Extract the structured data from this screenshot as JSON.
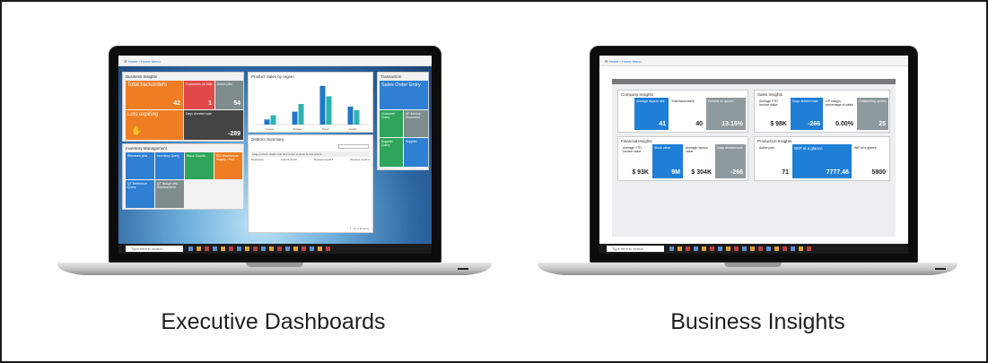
{
  "captions": {
    "left": "Executive Dashboards",
    "right": "Business Insights"
  },
  "left_screen": {
    "breadcrumb": "Home  ›  Home Menu",
    "business_insights": {
      "title": "Business Insights",
      "tiles": [
        {
          "label": "Total backorders",
          "value": "42"
        },
        {
          "label": "Customers on hold",
          "value": "1"
        },
        {
          "label": "Active jobs",
          "value": "54"
        },
        {
          "label": "Lots expiring",
          "value": ""
        },
        {
          "label": "Days directed sale",
          "value": "-289"
        }
      ]
    },
    "inventory_management": {
      "title": "Inventory Management",
      "tiles": [
        "Released jobs",
        "Inventory Query",
        "Stock Counts",
        "EDI Warehouse Supply / Fwd",
        "QT Reference Query",
        "QT Assign with Replacement"
      ]
    },
    "product_sales": {
      "title": "Product Sales by region",
      "categories": [
        "Leisure",
        "Outdoor",
        "Travel",
        "Hobby"
      ],
      "series": [
        {
          "color": "#1f77c9",
          "values": [
            10,
            25,
            75,
            35
          ]
        },
        {
          "color": "#2bb3b0",
          "values": [
            18,
            40,
            55,
            28
          ]
        }
      ]
    },
    "debtors_summary": {
      "title": "Debtors Summary",
      "hint": "Drag a column header and drop it here to group by that column",
      "columns": [
        "Description",
        "Current month",
        "Previous month 1",
        "Previous month 2"
      ],
      "footer": "1 - 11 of 11 items"
    },
    "transaction": {
      "title": "Transaction",
      "tiles": [
        "Sales Order Entry",
        "Customer Query",
        "AP Invoice Document",
        "Supplier Query",
        "Supplier"
      ]
    },
    "taskbar_search": "Type here to search"
  },
  "right_screen": {
    "breadcrumb": "Home  ›  Home Menu",
    "company_insights": {
      "title": "Company Insights",
      "tiles": [
        {
          "label": "Average days to sell",
          "value": "41"
        },
        {
          "label": "Total backorders",
          "value": "40"
        },
        {
          "label": "Returns on quotes",
          "value": "13.16%"
        }
      ]
    },
    "sales_insights": {
      "title": "Sales Insights",
      "tiles": [
        {
          "label": "Average YTD Invoice value",
          "value": "$ 98K"
        },
        {
          "label": "Days directed sale",
          "value": "-266"
        },
        {
          "label": "GP margin percentage of sales",
          "value": "0.00%"
        },
        {
          "label": "Outstanding quotes",
          "value": "25"
        }
      ]
    },
    "financial_insights": {
      "title": "Financial Insights",
      "tiles": [
        {
          "label": "Average YTD Invoice value",
          "value": "$ 93K"
        },
        {
          "label": "Stock value",
          "value": "9M"
        },
        {
          "label": "Average invoice value",
          "value": "$ 304K"
        },
        {
          "label": "Days directed sale",
          "value": "-266"
        }
      ]
    },
    "production_insights": {
      "title": "Production Insights",
      "tiles": [
        {
          "label": "Active jobs",
          "value": "71"
        },
        {
          "label": "WIP at a glance",
          "value": "7777.46"
        },
        {
          "label": "WIP at a glance",
          "value": "5800"
        }
      ]
    },
    "taskbar_search": "Type here to search"
  }
}
